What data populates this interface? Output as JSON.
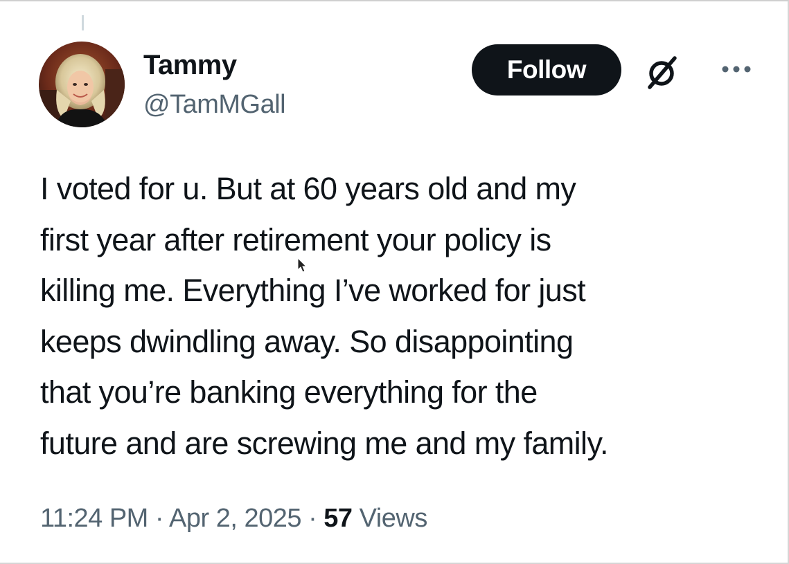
{
  "post": {
    "author": {
      "display_name": "Tammy",
      "handle": "@TamMGall",
      "avatar_icon": "profile-photo"
    },
    "follow_label": "Follow",
    "icons": {
      "grok": "grok-icon",
      "more": "more-options-icon"
    },
    "text_lines": [
      "I voted for u.  But at 60 years old and my",
      "first year after retirement your policy is",
      "killing me. Everything I’ve worked for just",
      "keeps dwindling away. So disappointing",
      "that you’re banking everything for the",
      "future and are screwing me and my family."
    ],
    "meta": {
      "time": "11:24 PM",
      "separator": " · ",
      "date": "Apr 2, 2025",
      "views_count": "57",
      "views_label": "Views"
    }
  },
  "colors": {
    "text_primary": "#0f1419",
    "text_secondary": "#536471",
    "button_bg": "#0f1419",
    "button_text": "#ffffff",
    "background": "#ffffff"
  }
}
